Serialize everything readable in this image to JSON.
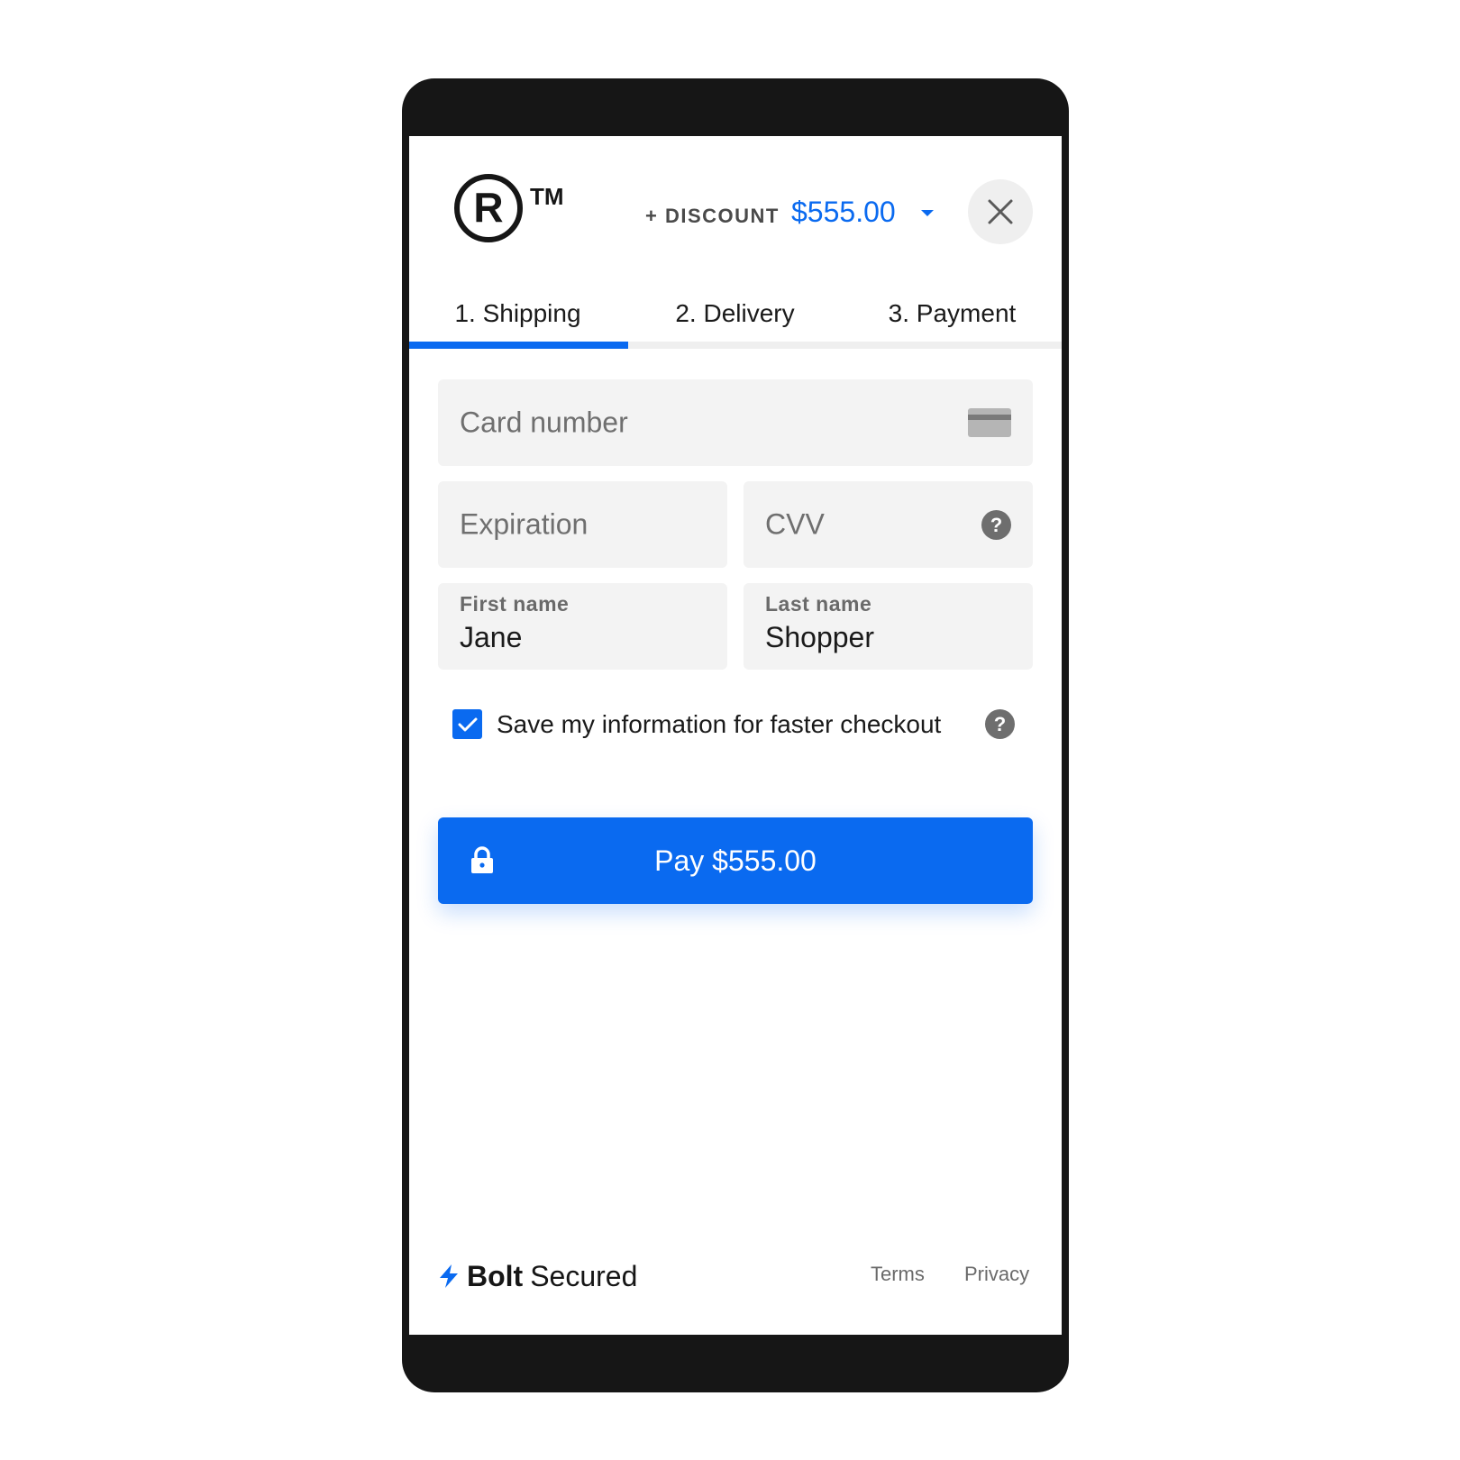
{
  "header": {
    "discount_label": "+ DISCOUNT",
    "total": "$555.00",
    "close_icon": "close-icon",
    "logo_icon": "registered-trademark-logo"
  },
  "tabs": [
    {
      "label": "1. Shipping",
      "active": true
    },
    {
      "label": "2. Delivery",
      "active": false
    },
    {
      "label": "3. Payment",
      "active": false
    }
  ],
  "form": {
    "card_number": {
      "placeholder": "Card number",
      "value": "",
      "icon": "credit-card-icon"
    },
    "expiration": {
      "placeholder": "Expiration",
      "value": ""
    },
    "cvv": {
      "placeholder": "CVV",
      "value": "",
      "help": "?"
    },
    "first_name": {
      "label": "First name",
      "value": "Jane"
    },
    "last_name": {
      "label": "Last name",
      "value": "Shopper"
    },
    "save_info": {
      "label": "Save my information for faster checkout",
      "checked": true,
      "help": "?"
    }
  },
  "pay_button": {
    "label": "Pay $555.00",
    "icon": "lock-icon"
  },
  "footer": {
    "brand": "Bolt",
    "secured": "Secured",
    "terms": "Terms",
    "privacy": "Privacy"
  },
  "colors": {
    "accent": "#0a6af0",
    "frame": "#161616",
    "field_bg": "#f3f3f3"
  }
}
